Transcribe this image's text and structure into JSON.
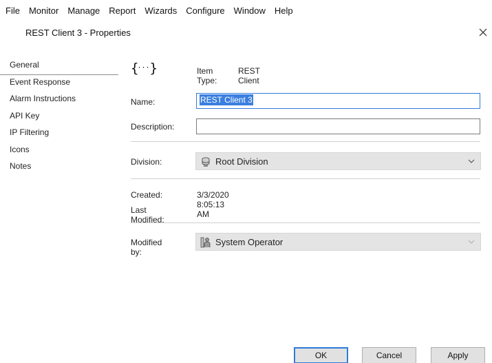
{
  "menubar": {
    "items": [
      "File",
      "Monitor",
      "Manage",
      "Report",
      "Wizards",
      "Configure",
      "Window",
      "Help"
    ]
  },
  "dialog": {
    "title": "REST Client 3 - Properties",
    "close_icon": "close-icon"
  },
  "nav": {
    "items": [
      "General",
      "Event Response",
      "Alarm Instructions",
      "API Key",
      "IP Filtering",
      "Icons",
      "Notes"
    ],
    "selected": "General"
  },
  "general": {
    "item_type_icon": "curly-braces-icon",
    "item_type_label": "Item Type:",
    "item_type_value": "REST Client",
    "name_label": "Name:",
    "name_value": "REST Client 3",
    "description_label": "Description:",
    "description_value": "",
    "division_label": "Division:",
    "division_value": "Root Division",
    "division_icon": "division-icon",
    "created_label": "Created:",
    "created_value": "3/3/2020 8:05:13 AM",
    "last_modified_label": "Last Modified:",
    "last_modified_value": "",
    "modified_by_label": "Modified by:",
    "modified_by_value": "System Operator",
    "modified_by_icon": "operator-icon"
  },
  "buttons": {
    "ok": "OK",
    "cancel": "Cancel",
    "apply": "Apply"
  },
  "colors": {
    "selection": "#3b7fe0",
    "focus_border": "#2f7bd9",
    "dropdown_bg": "#e4e4e4"
  }
}
